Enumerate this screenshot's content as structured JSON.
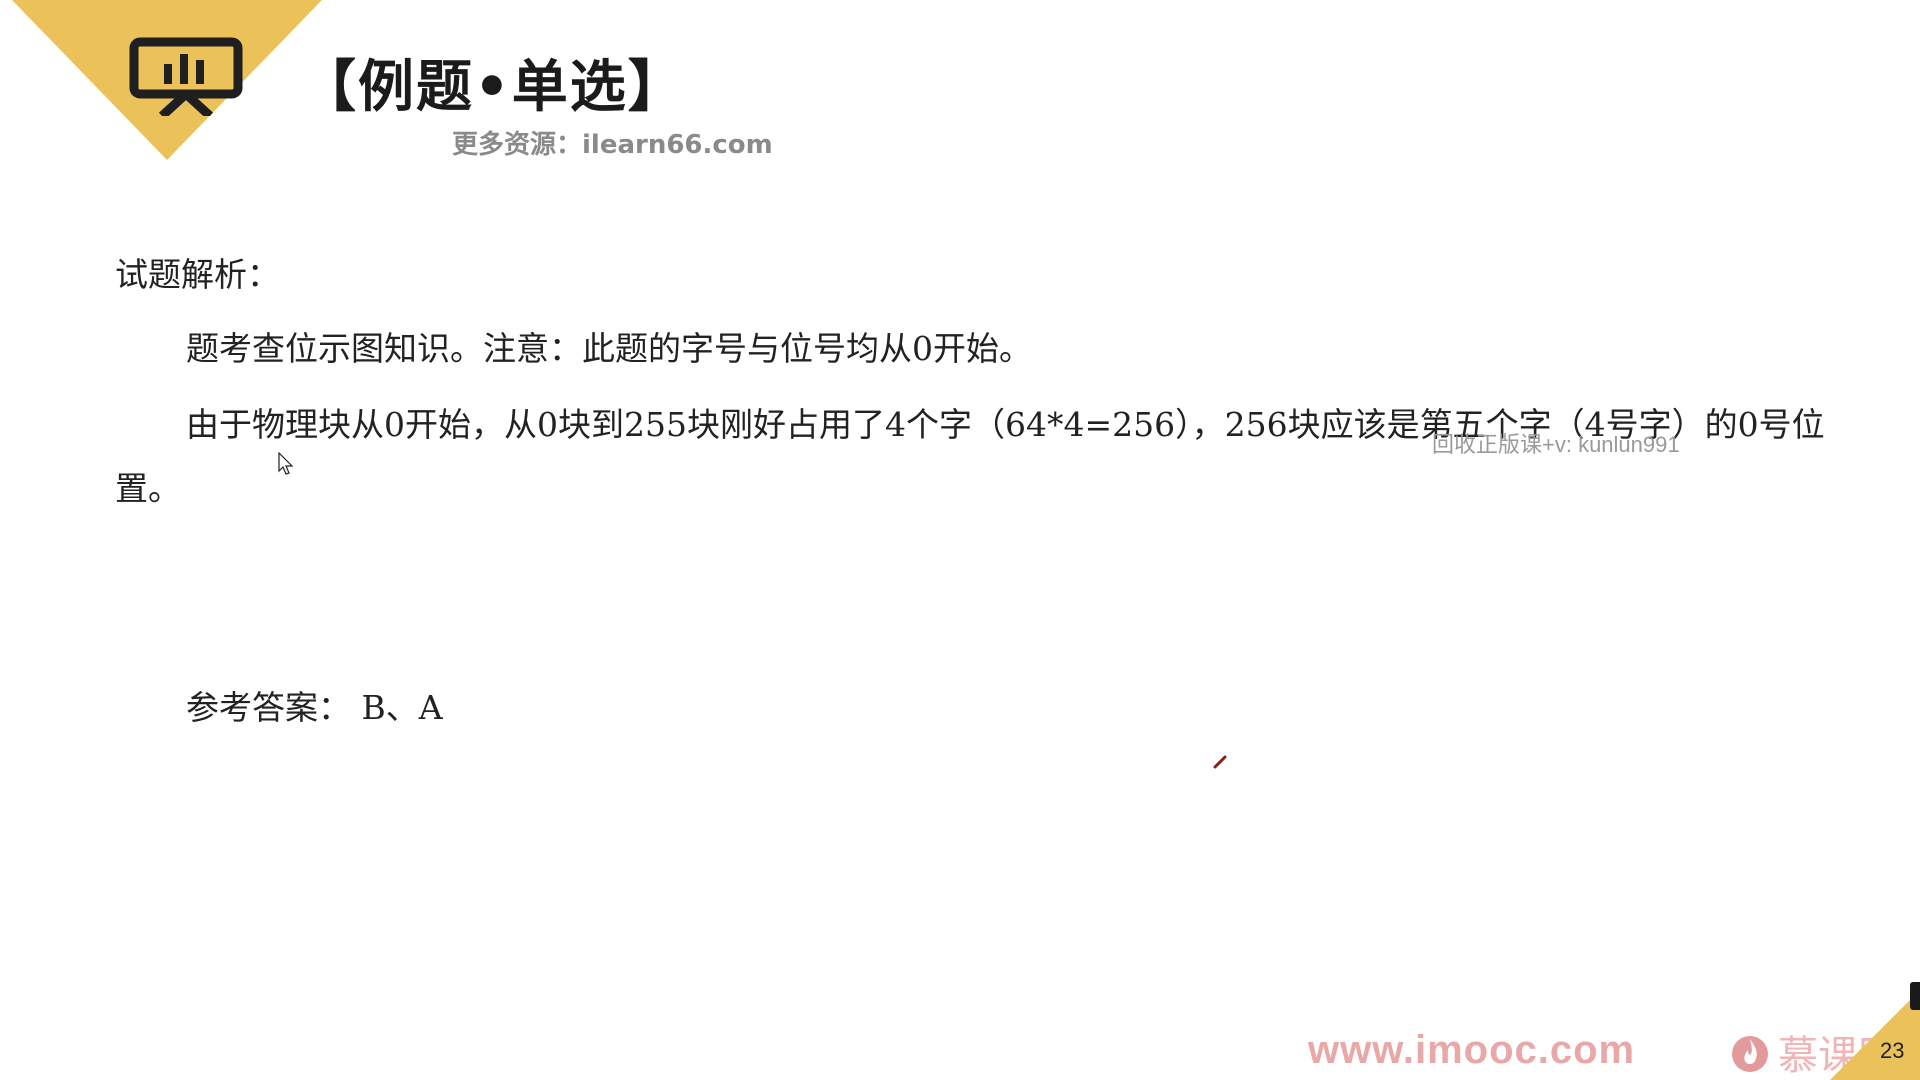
{
  "header": {
    "title": "【例题•单选】",
    "resource_line": "更多资源：ilearn66.com"
  },
  "content": {
    "analysis_heading": "试题解析：",
    "paragraph_1": "题考查位示图知识。注意：此题的字号与位号均从0开始。",
    "paragraph_2": "由于物理块从0开始，从0块到255块刚好占用了4个字（64*4=256），256块应该是第五个字（4号字）的0号位置。",
    "answer": "参考答案： B、A"
  },
  "watermark": "回收正版课+v: kunlun991",
  "footer": {
    "site_url": "www.imooc.com",
    "brand_name": "慕课网",
    "page_number": "23"
  },
  "colors": {
    "badge_yellow": "#EBC25A",
    "title_text": "#1B1B1B",
    "footer_pink": "#E8A8A8",
    "brand_red": "#D9534F"
  },
  "icons": {
    "badge": "presentation-board-icon",
    "cursor": "mouse-pointer-icon",
    "pen": "pen-mark-icon",
    "brand": "flame-icon"
  }
}
